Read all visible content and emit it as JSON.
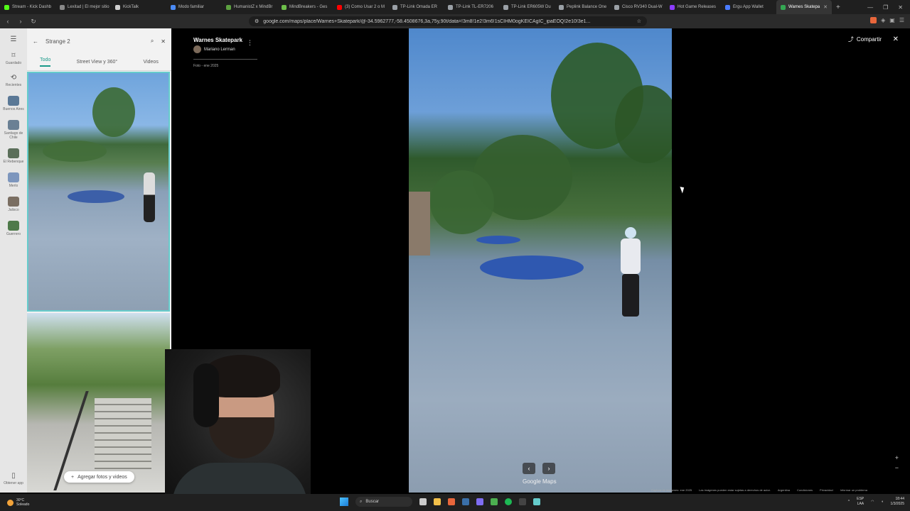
{
  "browser": {
    "tabs": [
      {
        "label": "Stream - Kick Dashb",
        "color": "#53fc18"
      },
      {
        "label": "Lexitad | El mejor sitio",
        "color": "#888888"
      },
      {
        "label": "KickTalk",
        "color": "#d0d0d0"
      },
      {
        "label": "Modo familiar",
        "color": "#4a8af4"
      },
      {
        "label": "HumanistZ x MindBr",
        "color": "#5ca040"
      },
      {
        "label": "MindBreakers - Ges",
        "color": "#6dbf4a"
      },
      {
        "label": "(3) Como Usar 2 o M",
        "color": "#ff0000"
      },
      {
        "label": "TP-Link Omada ER",
        "color": "#9aa0a6"
      },
      {
        "label": "TP-Link TL-ER7206",
        "color": "#9aa0a6"
      },
      {
        "label": "TP-Link ER605W Du",
        "color": "#9aa0a6"
      },
      {
        "label": "Peplink Balance One",
        "color": "#9aa0a6"
      },
      {
        "label": "Cisco RV340 Dual-W",
        "color": "#9aa0a6"
      },
      {
        "label": "Hot Game Releases",
        "color": "#8c3cff"
      },
      {
        "label": "Ergu App Wallet",
        "color": "#4a7cff"
      },
      {
        "label": "Warnes Skatepa",
        "color": "#34a853",
        "active": true
      }
    ],
    "url": "google.com/maps/place/Warnes+Skatepark/@-34.5962777,-58.4508676,3a,75y,90t/data=!3m8!1e2!3m6!1sCIHM0ogKEICAgIC_ipaEOQ!2e10!3e1..."
  },
  "rail": {
    "items": [
      {
        "label": "Guardado",
        "icon": "bookmark-icon"
      },
      {
        "label": "Recientes",
        "icon": "history-icon"
      },
      {
        "label": "Buenos Aires",
        "color": "#5a7896"
      },
      {
        "label": "Santiago de Chile",
        "color": "#6a8094"
      },
      {
        "label": "El Rebenque",
        "color": "#5b6f5a"
      },
      {
        "label": "Merlo",
        "color": "#7d96bd"
      },
      {
        "label": "Jalisco",
        "color": "#7a6e62"
      },
      {
        "label": "Guerrero",
        "color": "#4e7a4a"
      }
    ],
    "bottom_label": "Obtener app"
  },
  "panel": {
    "search_text": "Strange 2",
    "tabs": [
      "Todo",
      "Street View y 360°",
      "Videos"
    ],
    "add_button": "Agregar fotos y videos"
  },
  "viewer": {
    "place_title": "Warnes Skatepark",
    "author": "Mariano Lerman",
    "date": "Foto - ene 2025",
    "share_label": "Compartir",
    "brand": "Google Maps",
    "footer": [
      "Captura de imágenes: ene 2025",
      "Las imágenes pueden estar sujetas a derechos de autor.",
      "Argentina",
      "Condiciones",
      "Privacidad",
      "Informar un problema"
    ]
  },
  "taskbar": {
    "weather_temp": "30°C",
    "weather_desc": "Soleado",
    "search_label": "Buscar",
    "lang": "ESP",
    "lang2": "LAA",
    "time": "18:44",
    "date": "1/3/2025"
  }
}
